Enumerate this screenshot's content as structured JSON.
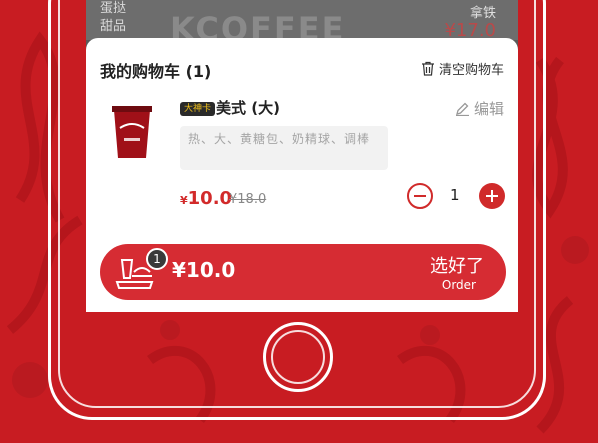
{
  "background_menu": {
    "category_lines": [
      "蛋挞",
      "甜品"
    ],
    "logo_text": "KCOFFEE",
    "item_name": "拿铁",
    "item_price": "¥17.0"
  },
  "cart": {
    "title": "我的购物车 (1)",
    "clear_label": "清空购物车",
    "items": [
      {
        "badge": "大神卡",
        "name": "美式 (大)",
        "edit_label": "编辑",
        "options": "热、大、黄糖包、奶精球、调棒",
        "currency": "¥",
        "price": "10.0",
        "original_price": "¥18.0",
        "quantity": "1"
      }
    ]
  },
  "checkout": {
    "count": "1",
    "total": "¥10.0",
    "button_cn": "选好了",
    "button_en": "Order"
  },
  "colors": {
    "brand_red": "#c81c22",
    "button_red": "#d62c33",
    "badge_yellow": "#f2c21b"
  }
}
